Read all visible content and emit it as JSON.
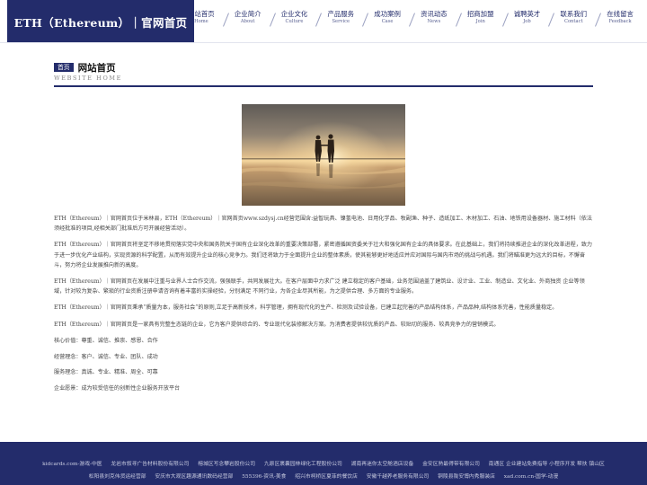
{
  "header": {
    "logo_text": "ETH（Ethereum）｜官网首页",
    "nav": [
      {
        "cn": "网站首页",
        "en": "Home"
      },
      {
        "cn": "企业简介",
        "en": "About"
      },
      {
        "cn": "企业文化",
        "en": "Culture"
      },
      {
        "cn": "产品服务",
        "en": "Service"
      },
      {
        "cn": "成功案例",
        "en": "Case"
      },
      {
        "cn": "资讯动态",
        "en": "News"
      },
      {
        "cn": "招商加盟",
        "en": "Join"
      },
      {
        "cn": "诚聘英才",
        "en": "Job"
      },
      {
        "cn": "联系我们",
        "en": "Contact"
      },
      {
        "cn": "在线留言",
        "en": "Feedback"
      }
    ]
  },
  "section": {
    "badge": "首页",
    "title": "网站首页",
    "subtitle": "WEBSITE HOME"
  },
  "paragraphs": [
    "ETH（Ethereum）｜官网首页位于米林县，ETH（Ethereum）｜官网首页www.szdysj.cn经营范围含:益智玩具、镍氢电池、日用化学品、牧副渔、种子、造纸加工、木材加工、石油、地铁用设备器材、施工材料（依法须经批准的项目,经相关部门批准后方可开展经营活动）。",
    "ETH（Ethereum）｜官网首页将坚定不移地贯彻落实党中央和国务院关于国有企业深化改革的重要决策部署，紧密遵循国资委关于壮大和强化国有企业的具体要求。在此基础上，我们将持续推进企业的深化改革进程，致力于进一步优化产业结构，实现资源的科学配置，从而有效提升企业的核心竞争力。我们还将致力于全面提升企业的整体素质，使其能够更好地适应并应对国际与国内市场的挑战与机遇。我们将瞄准更为远大的目标，不懈奋斗，努力将企业发展推向新的高度。",
    "ETH（Ethereum）｜官网首页在发展中注重与业界人士合作交流，强强联手，共同发展壮大。在客户层面中力求广泛 建立稳定的客户基础，业务范围涵盖了建筑业、设计业、工业、制造业、文化业、外商独资 企业等领域，针对较为复杂、繁琐的行业资质注册申请咨询有着丰富的实操经验，分别满足 不同行业，为各企业尽其所能，为之提供合理、多方面的专业服务。",
    "ETH（Ethereum）｜官网首页秉承“质量为本，服务社会”的原则,立足于高新技术，科学管理，拥有现代化的生产、检测及试验设备，已建立起完善的产品结构体系，产品品种,结构体系完善，性能质量稳定。",
    "ETH（Ethereum）｜官网首页是一家具有完整生态链的企业，它为客户提供综合的、专业现代化装修解决方案。为消费者提供较优质的产品、较贴切的服务、较具竞争力的营销模式。",
    "核心价值：尊重、诚信、推崇、感恩、合作",
    "经营理念：客户、诚信、专业、团队、成功",
    "服务理念：真诚、专业、精准、周全、可靠",
    "企业愿景：成为较受信任的创新性企业服务开放平台"
  ],
  "footer": {
    "row1": [
      "kidcards.com-游戏-中医",
      "龙岩市叙寻广告材料股份有限公司",
      "榕城区写念攀岩股份公司",
      "九原区裹囊园林绿化工程股份公司",
      "湖南再迷你太空舱酒店设备",
      "金安区熟最得带有限公司",
      "南通区 企业建站免费指导 小程序开发 帮扶 镇山区"
    ],
    "row2": [
      "松阳县刘克伟货运经营部",
      "安庆市大观区趣源通讯数码经营部",
      "555396-资讯-美食",
      "绍兴市柯桥区夏菲的餐饮店",
      "安徽千越养老服务有限公司",
      "铜陵县陇安博内秀服装店",
      "xad.com.cn-国学-动漫"
    ]
  }
}
